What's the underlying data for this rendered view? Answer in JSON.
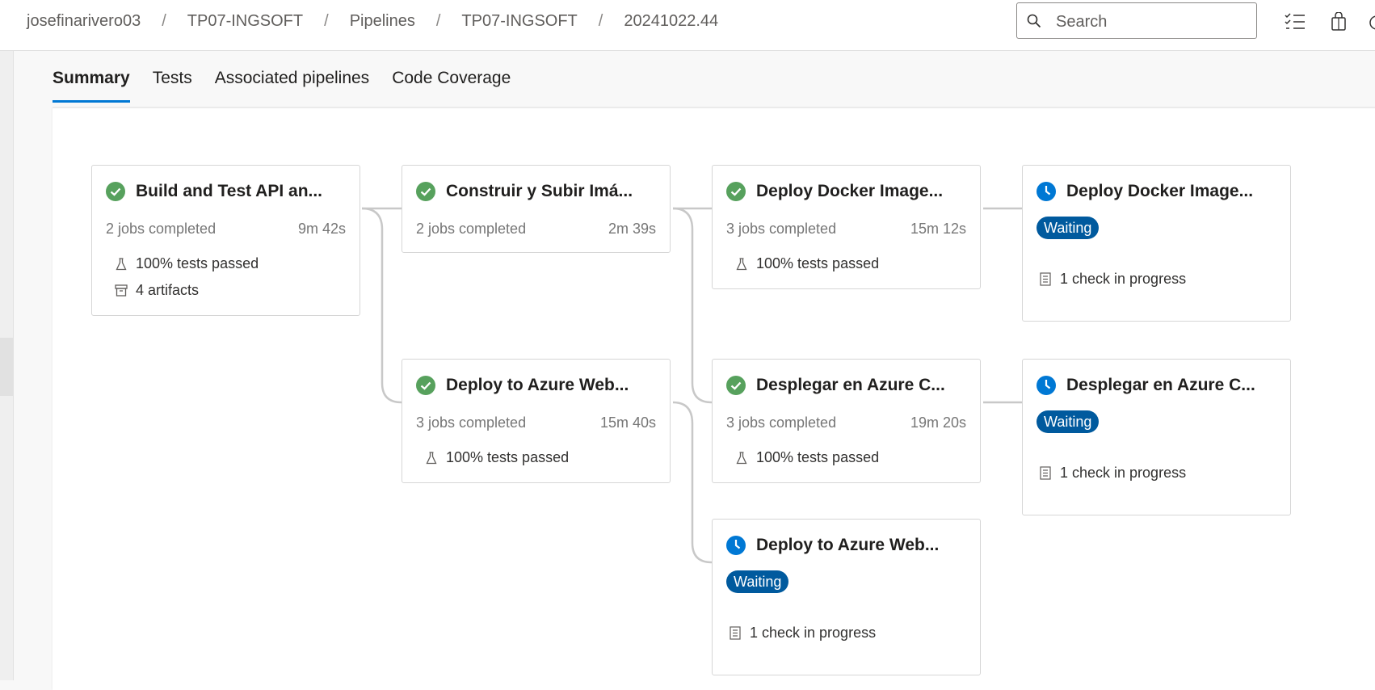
{
  "breadcrumb": {
    "items": [
      "josefinarivero03",
      "TP07-INGSOFT",
      "Pipelines",
      "TP07-INGSOFT",
      "20241022.44"
    ],
    "separator": "/"
  },
  "search": {
    "placeholder": "Search",
    "icon": "search-icon"
  },
  "header_icons": [
    "task-list-icon",
    "shopping-bag-icon"
  ],
  "tabs": [
    {
      "label": "Summary",
      "active": true
    },
    {
      "label": "Tests",
      "active": false
    },
    {
      "label": "Associated pipelines",
      "active": false
    },
    {
      "label": "Code Coverage",
      "active": false
    }
  ],
  "colors": {
    "success": "#57a15d",
    "waiting": "#0078d4",
    "badge": "#005a9e",
    "accent": "#0078d4"
  },
  "stages": [
    {
      "id": "s1",
      "title": "Build and Test API an...",
      "status": "success",
      "jobs": "2 jobs completed",
      "duration": "9m 42s",
      "tests": "100% tests passed",
      "artifacts": "4 artifacts"
    },
    {
      "id": "s2",
      "title": "Construir y Subir Imá...",
      "status": "success",
      "jobs": "2 jobs completed",
      "duration": "2m 39s"
    },
    {
      "id": "s3",
      "title": "Deploy Docker Image...",
      "status": "success",
      "jobs": "3 jobs completed",
      "duration": "15m 12s",
      "tests": "100% tests passed"
    },
    {
      "id": "s4",
      "title": "Deploy Docker Image...",
      "status": "waiting",
      "badge": "Waiting",
      "check": "1 check in progress"
    },
    {
      "id": "s5",
      "title": "Deploy to Azure Web...",
      "status": "success",
      "jobs": "3 jobs completed",
      "duration": "15m 40s",
      "tests": "100% tests passed"
    },
    {
      "id": "s6",
      "title": "Desplegar en Azure C...",
      "status": "success",
      "jobs": "3 jobs completed",
      "duration": "19m 20s",
      "tests": "100% tests passed"
    },
    {
      "id": "s7",
      "title": "Desplegar en Azure C...",
      "status": "waiting",
      "badge": "Waiting",
      "check": "1 check in progress"
    },
    {
      "id": "s8",
      "title": "Deploy to Azure Web...",
      "status": "waiting",
      "badge": "Waiting",
      "check": "1 check in progress"
    }
  ]
}
